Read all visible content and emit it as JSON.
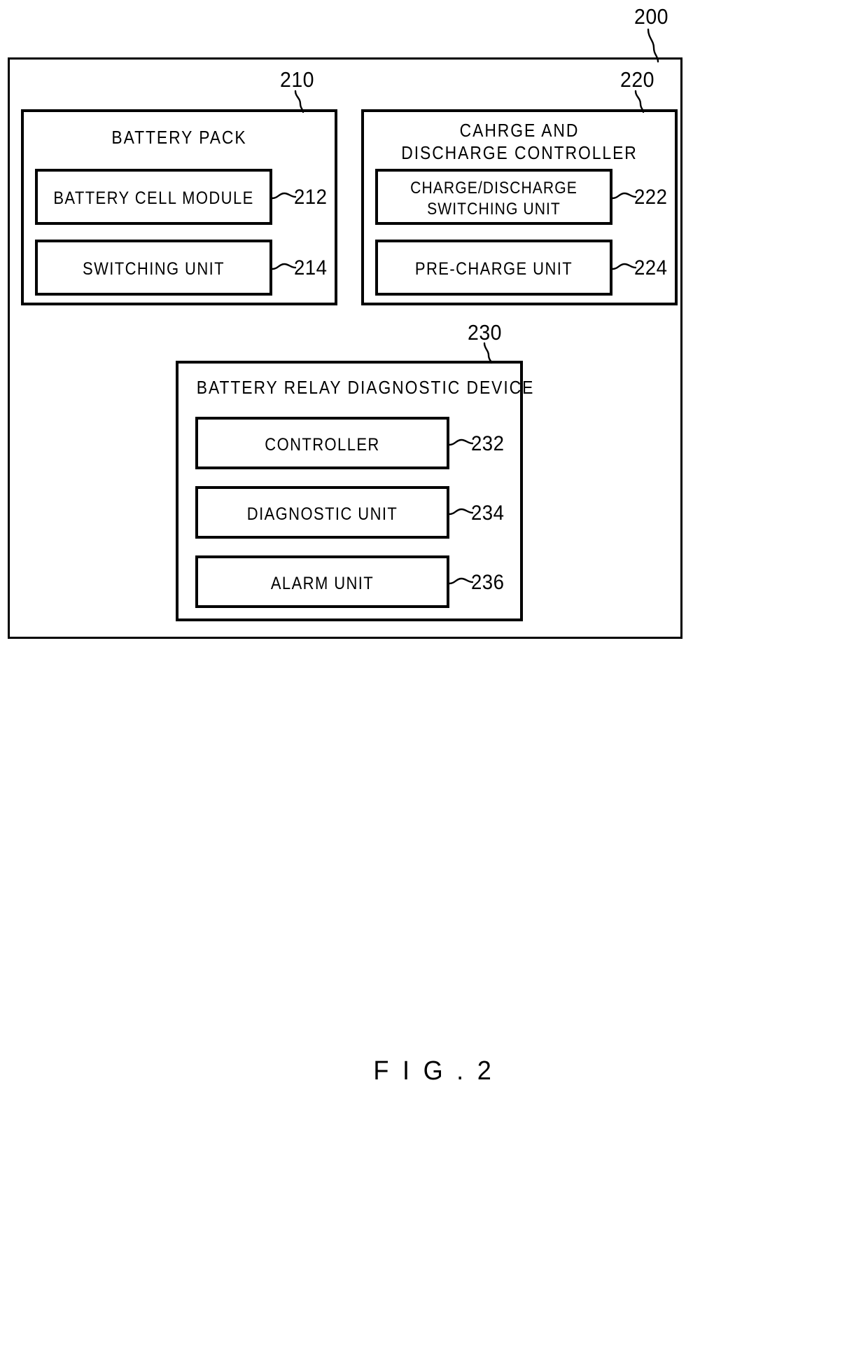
{
  "figure": {
    "caption": "F I G . 2",
    "outer_ref": "200"
  },
  "blocks": {
    "battery_pack": {
      "ref": "210",
      "title": "BATTERY PACK",
      "units": [
        {
          "ref": "212",
          "title": "BATTERY CELL MODULE"
        },
        {
          "ref": "214",
          "title": "SWITCHING UNIT"
        }
      ]
    },
    "charge_discharge_controller": {
      "ref": "220",
      "title_line1": "CAHRGE AND",
      "title_line2": "DISCHARGE CONTROLLER",
      "units": [
        {
          "ref": "222",
          "title_line1": "CHARGE/DISCHARGE",
          "title_line2": "SWITCHING UNIT"
        },
        {
          "ref": "224",
          "title": "PRE-CHARGE UNIT"
        }
      ]
    },
    "battery_relay_diagnostic_device": {
      "ref": "230",
      "title": "BATTERY RELAY DIAGNOSTIC DEVICE",
      "units": [
        {
          "ref": "232",
          "title": "CONTROLLER"
        },
        {
          "ref": "234",
          "title": "DIAGNOSTIC UNIT"
        },
        {
          "ref": "236",
          "title": "ALARM UNIT"
        }
      ]
    }
  },
  "style": {
    "line_color": "#000000",
    "background": "#ffffff"
  }
}
